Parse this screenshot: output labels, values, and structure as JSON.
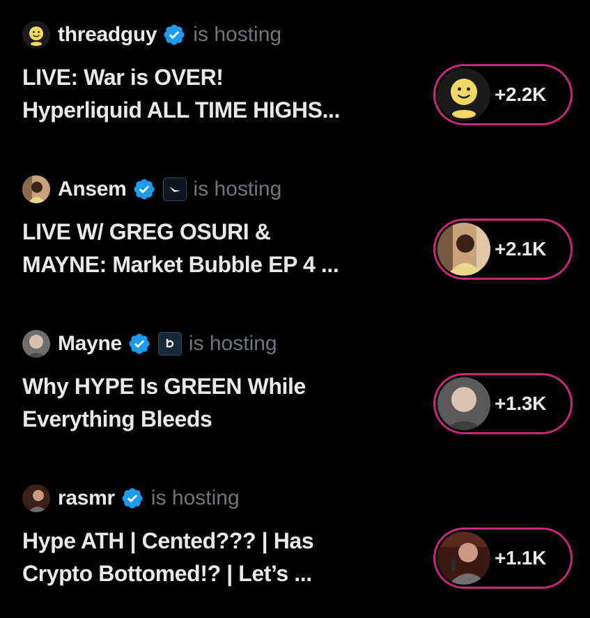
{
  "spaces": [
    {
      "host": "threadguy",
      "status": "is hosting",
      "title_line1": "LIVE: War is OVER!",
      "title_line2": "Hyperliquid ALL TIME HIGHS...",
      "count": "+2.2K",
      "avatar_icon": "smiley-avatar",
      "affiliate_icon": ""
    },
    {
      "host": "Ansem",
      "status": "is hosting",
      "title_line1": "LIVE W/ GREG OSURI &",
      "title_line2": "MAYNE: Market Bubble EP 4 ...",
      "count": "+2.1K",
      "avatar_icon": "photo-avatar",
      "affiliate_icon": "wing-badge-icon"
    },
    {
      "host": "Mayne",
      "status": "is hosting",
      "title_line1": "Why HYPE Is GREEN While",
      "title_line2": "Everything Bleeds",
      "count": "+1.3K",
      "avatar_icon": "photo-avatar",
      "affiliate_icon": "b-badge-icon"
    },
    {
      "host": "rasmr",
      "status": "is hosting",
      "title_line1": "Hype ATH | Cented??? | Has",
      "title_line2": "Crypto Bottomed!? | Let’s ...",
      "count": "+1.1K",
      "avatar_icon": "photo-avatar",
      "affiliate_icon": ""
    }
  ],
  "colors": {
    "background": "#000000",
    "text": "#e7e9ea",
    "muted": "#71767b",
    "verified": "#1d9bf0",
    "pill_border": "#c9267e"
  }
}
